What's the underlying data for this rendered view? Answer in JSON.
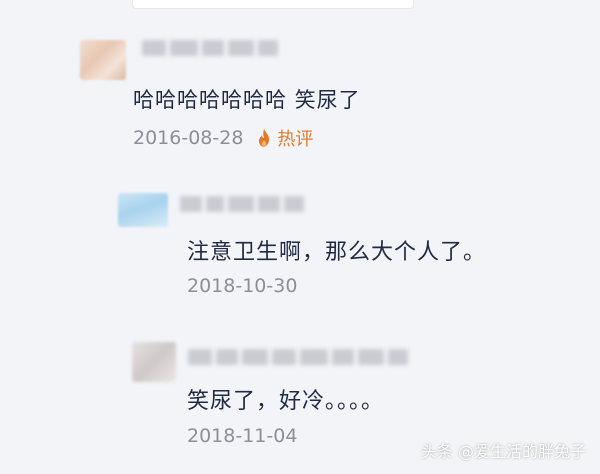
{
  "comments": [
    {
      "text": "哈哈哈哈哈哈哈 笑尿了",
      "date": "2016-08-28",
      "badge": "热评",
      "icon": "fire-icon"
    }
  ],
  "replies": [
    {
      "text": "注意卫生啊，那么大个人了。",
      "date": "2018-10-30"
    },
    {
      "text": "笑尿了，好冷。。。。",
      "date": "2018-11-04"
    }
  ],
  "watermark": "头条 @爱生活的胖兔子",
  "colors": {
    "background": "#f3f4f7",
    "text": "#1f2a44",
    "meta": "#8b8f98",
    "hot": "#e07b2b"
  }
}
